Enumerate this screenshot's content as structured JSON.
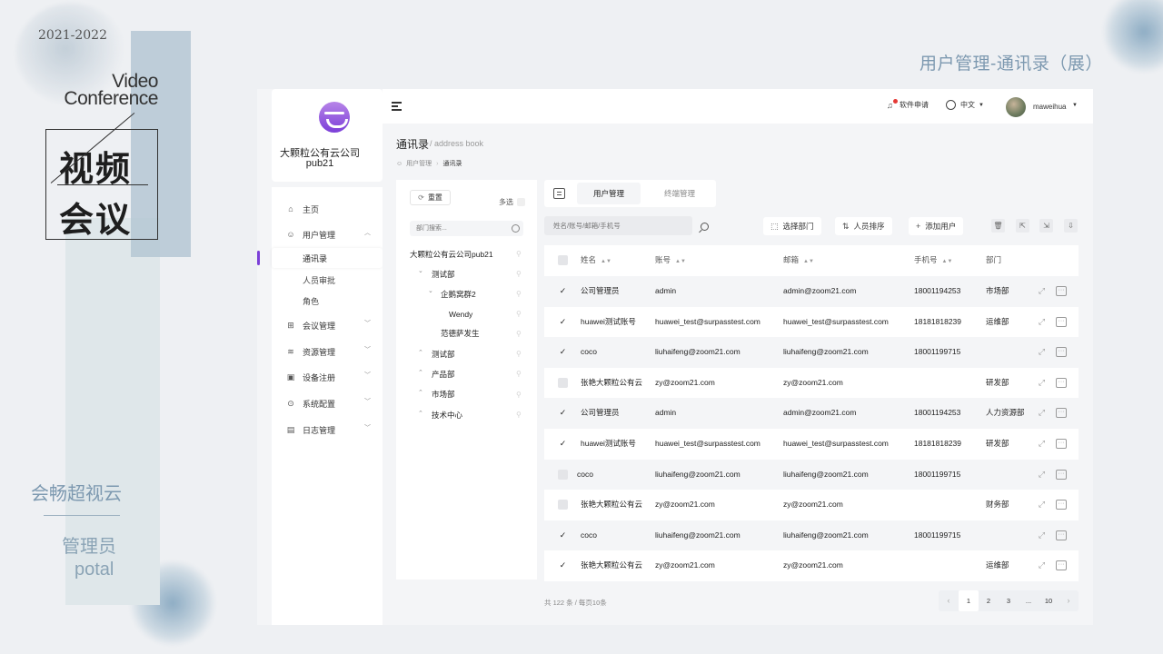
{
  "slide": {
    "year": "2021-2022",
    "title_line1": "Video",
    "title_line2": "Conference",
    "seal_line1": "视频",
    "seal_line2": "会议",
    "brand": "会畅超视云",
    "role_cn": "管理员",
    "role_en": "potal",
    "page_heading": "用户管理-通讯录（展）"
  },
  "app": {
    "org_name": "大颗粒公有云公司",
    "org_code": "pub21",
    "menu": [
      {
        "label": "主页",
        "icon": "home-icon",
        "glyph": "⌂"
      },
      {
        "label": "用户管理",
        "icon": "user-icon",
        "glyph": "☺",
        "expanded": true
      },
      {
        "label": "会议管理",
        "icon": "meeting-icon",
        "glyph": "⊞"
      },
      {
        "label": "资源管理",
        "icon": "layers-icon",
        "glyph": "≋"
      },
      {
        "label": "设备注册",
        "icon": "device-icon",
        "glyph": "▣"
      },
      {
        "label": "系统配置",
        "icon": "settings-icon",
        "glyph": "⊙"
      },
      {
        "label": "日志管理",
        "icon": "log-icon",
        "glyph": "▤"
      }
    ],
    "submenu": [
      "通讯录",
      "人员审批",
      "角色"
    ],
    "topbar": {
      "apply": "软件申请",
      "language": "中文",
      "username": "maweihua"
    },
    "content": {
      "title": "通讯录",
      "subtitle": "address book",
      "breadcrumb": [
        "用户管理",
        "通讯录"
      ]
    },
    "tree": {
      "reset": "重置",
      "multi": "多选",
      "search_placeholder": "部门搜索...",
      "nodes": [
        {
          "label": "大颗粒公有云公司pub21",
          "depth": 0,
          "arrow": ""
        },
        {
          "label": "测试部",
          "depth": 1,
          "arrow": "⌄"
        },
        {
          "label": "企鹅窝群2",
          "depth": 2,
          "arrow": "⌄"
        },
        {
          "label": "Wendy",
          "depth": 3,
          "arrow": ""
        },
        {
          "label": "范德萨发生",
          "depth": 2,
          "arrow": ""
        },
        {
          "label": "测试部",
          "depth": 1,
          "arrow": "⌃"
        },
        {
          "label": "产品部",
          "depth": 1,
          "arrow": "⌃"
        },
        {
          "label": "市场部",
          "depth": 1,
          "arrow": "⌃"
        },
        {
          "label": "技术中心",
          "depth": 1,
          "arrow": "⌃"
        }
      ]
    },
    "tabs": [
      "用户管理",
      "终端管理"
    ],
    "search_placeholder": "姓名/账号/邮箱/手机号",
    "actions": [
      {
        "label": "选择部门",
        "glyph": "⬚"
      },
      {
        "label": "人员排序",
        "glyph": "⇅"
      },
      {
        "label": "添加用户",
        "glyph": "+"
      }
    ],
    "table": {
      "headers": [
        "姓名",
        "账号",
        "邮箱",
        "手机号",
        "部门"
      ],
      "rows": [
        {
          "checked": true,
          "name": "公司管理员",
          "account": "admin",
          "email": "admin@zoom21.com",
          "phone": "18001194253",
          "dept": "市场部"
        },
        {
          "checked": true,
          "name": "huawei测试账号",
          "account": "huawei_test@surpasstest.com",
          "email": "huawei_test@surpasstest.com",
          "phone": "18181818239",
          "dept": "运维部"
        },
        {
          "checked": true,
          "name": "coco",
          "account": "liuhaifeng@zoom21.com",
          "email": "liuhaifeng@zoom21.com",
          "phone": "18001199715",
          "dept": ""
        },
        {
          "checked": false,
          "name": "张艳大颗粒公有云",
          "account": "zy@zoom21.com",
          "email": "zy@zoom21.com",
          "phone": "",
          "dept": "研发部"
        },
        {
          "checked": true,
          "name": "公司管理员",
          "account": "admin",
          "email": "admin@zoom21.com",
          "phone": "18001194253",
          "dept": "人力资源部"
        },
        {
          "checked": true,
          "name": "huawei测试账号",
          "account": "huawei_test@surpasstest.com",
          "email": "huawei_test@surpasstest.com",
          "phone": "18181818239",
          "dept": "研发部"
        },
        {
          "checked": false,
          "name": "coco",
          "account": "liuhaifeng@zoom21.com",
          "email": "liuhaifeng@zoom21.com",
          "phone": "18001199715",
          "dept": ""
        },
        {
          "checked": false,
          "name": "张艳大颗粒公有云",
          "account": "zy@zoom21.com",
          "email": "zy@zoom21.com",
          "phone": "",
          "dept": "财务部"
        },
        {
          "checked": true,
          "name": "coco",
          "account": "liuhaifeng@zoom21.com",
          "email": "liuhaifeng@zoom21.com",
          "phone": "18001199715",
          "dept": ""
        },
        {
          "checked": true,
          "name": "张艳大颗粒公有云",
          "account": "zy@zoom21.com",
          "email": "zy@zoom21.com",
          "phone": "",
          "dept": "运维部"
        }
      ]
    },
    "pagination": {
      "total": "共 122 条 / 每页10条",
      "pages": [
        "1",
        "2",
        "3",
        "...",
        "10"
      ],
      "current": "1",
      "prev": "‹",
      "next": "›"
    }
  }
}
